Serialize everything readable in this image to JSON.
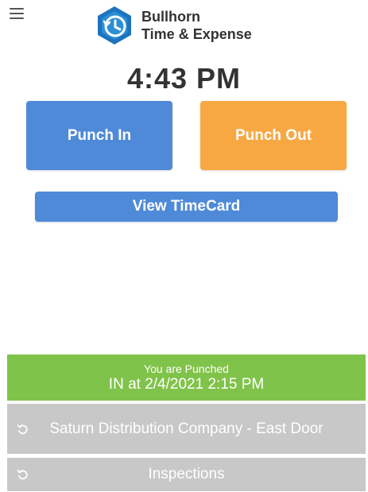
{
  "header": {
    "logo_line1": "Bullhorn",
    "logo_line2": "Time & Expense",
    "menu_icon": "hamburger-menu-icon",
    "logo_icon": "clock-hexagon-icon"
  },
  "clock": {
    "time": "4:43 PM"
  },
  "actions": {
    "punch_in_label": "Punch In",
    "punch_out_label": "Punch Out",
    "view_timecard_label": "View TimeCard"
  },
  "status": {
    "label": "You are Punched",
    "value": "IN at 2/4/2021 2:15 PM"
  },
  "list": {
    "items": [
      {
        "label": "Saturn Distribution Company - East Door",
        "icon": "undo-icon"
      },
      {
        "label": "Inspections",
        "icon": "undo-icon"
      }
    ]
  },
  "colors": {
    "primary_blue": "#4f8ad8",
    "punch_out_orange": "#f8a843",
    "status_green": "#80c34a",
    "list_gray": "#c8c8c8"
  }
}
